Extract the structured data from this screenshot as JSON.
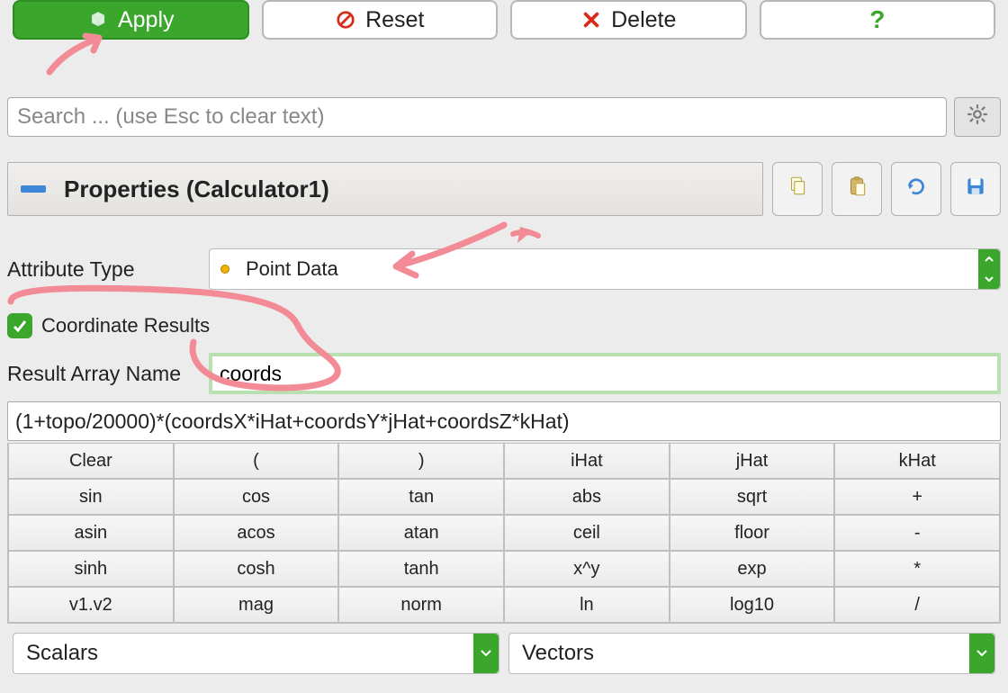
{
  "toolbar": {
    "apply_label": "Apply",
    "reset_label": "Reset",
    "delete_label": "Delete",
    "help_label": "?"
  },
  "search": {
    "placeholder": "Search ... (use Esc to clear text)",
    "value": ""
  },
  "section": {
    "title": "Properties (Calculator1)"
  },
  "form": {
    "attribute_type_label": "Attribute Type",
    "attribute_type_value": "Point Data",
    "coordinate_results_label": "Coordinate Results",
    "coordinate_results_checked": true,
    "result_array_name_label": "Result Array Name",
    "result_array_name_value": "coords",
    "formula": "(1+topo/20000)*(coordsX*iHat+coordsY*jHat+coordsZ*kHat)"
  },
  "calc_grid": [
    [
      "Clear",
      "(",
      ")",
      "iHat",
      "jHat",
      "kHat"
    ],
    [
      "sin",
      "cos",
      "tan",
      "abs",
      "sqrt",
      "+"
    ],
    [
      "asin",
      "acos",
      "atan",
      "ceil",
      "floor",
      "-"
    ],
    [
      "sinh",
      "cosh",
      "tanh",
      "x^y",
      "exp",
      "*"
    ],
    [
      "v1.v2",
      "mag",
      "norm",
      "ln",
      "log10",
      "/"
    ]
  ],
  "selectors": {
    "scalars_label": "Scalars",
    "vectors_label": "Vectors"
  },
  "icons": {
    "apply": "cube-icon",
    "reset": "prohibit-icon",
    "delete": "x-icon",
    "help": "question-icon",
    "gear": "gear-icon",
    "copy": "copy-icon",
    "paste": "paste-icon",
    "refresh": "refresh-icon",
    "save": "save-icon"
  },
  "colors": {
    "accent_green": "#3aa62b",
    "annotation_pink": "#f28b95"
  }
}
